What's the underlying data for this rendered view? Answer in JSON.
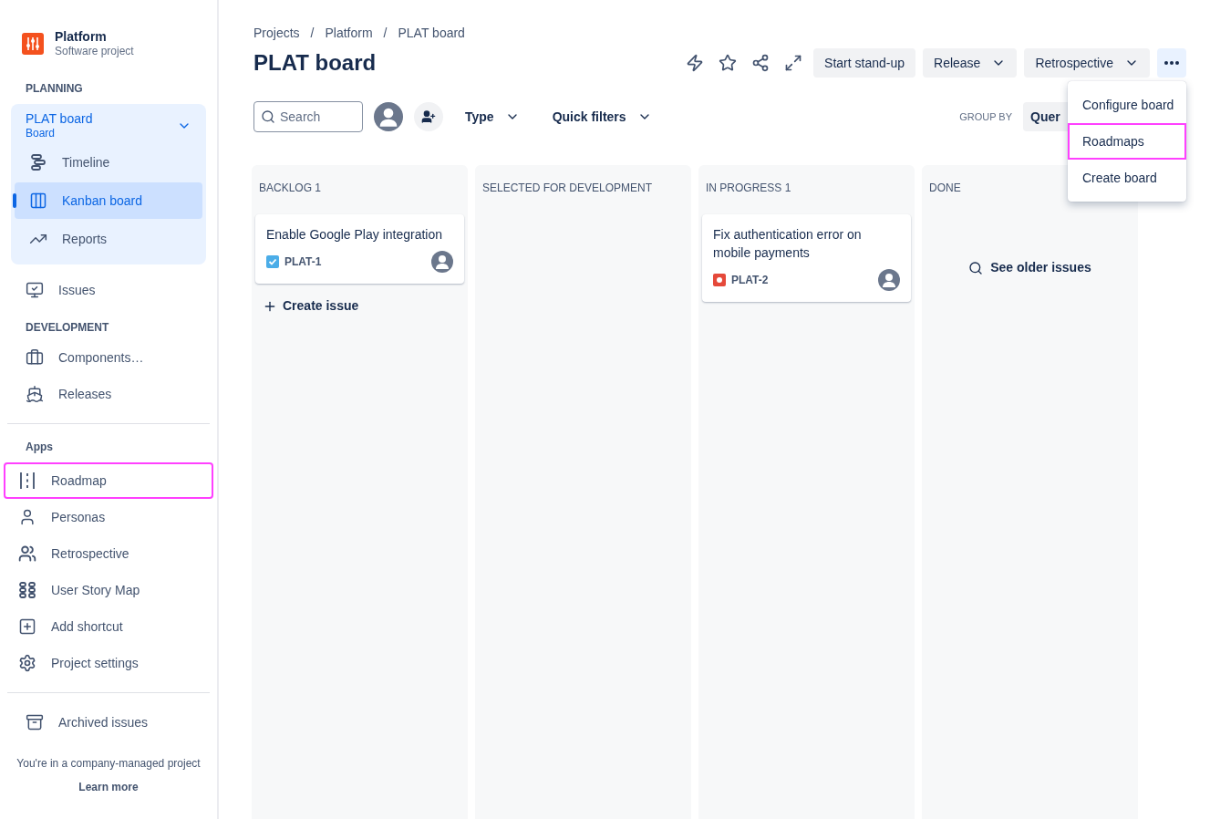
{
  "sidebar": {
    "project": {
      "name": "Platform",
      "type": "Software project"
    },
    "planning": {
      "heading": "PLANNING",
      "board": {
        "name": "PLAT board",
        "subtitle": "Board",
        "expanded": true
      },
      "items": [
        {
          "label": "Timeline",
          "selected": false
        },
        {
          "label": "Kanban board",
          "selected": true
        },
        {
          "label": "Reports",
          "selected": false
        }
      ]
    },
    "issues": {
      "label": "Issues"
    },
    "development": {
      "heading": "DEVELOPMENT",
      "items": [
        {
          "label": "Components…"
        },
        {
          "label": "Releases"
        }
      ]
    },
    "apps": {
      "heading": "Apps",
      "items": [
        {
          "label": "Roadmap",
          "highlighted": true
        },
        {
          "label": "Personas",
          "highlighted": false
        },
        {
          "label": "Retrospective",
          "highlighted": false
        },
        {
          "label": "User Story Map",
          "highlighted": false
        },
        {
          "label": "Add shortcut",
          "highlighted": false
        },
        {
          "label": "Project settings",
          "highlighted": false
        }
      ]
    },
    "archived": {
      "label": "Archived issues"
    },
    "footer": {
      "text": "You're in a company-managed project",
      "link": "Learn more"
    }
  },
  "breadcrumbs": {
    "separator": "/",
    "items": [
      "Projects",
      "Platform",
      "PLAT board"
    ]
  },
  "title": "PLAT board",
  "actions": {
    "buttons": [
      {
        "label": "Start stand-up",
        "dropdown": false
      },
      {
        "label": "Release",
        "dropdown": true
      },
      {
        "label": "Retrospective",
        "dropdown": true
      }
    ],
    "more_open": true
  },
  "more_menu": [
    {
      "label": "Configure board",
      "highlighted": false
    },
    {
      "label": "Roadmaps",
      "highlighted": true
    },
    {
      "label": "Create board",
      "highlighted": false
    }
  ],
  "filters": {
    "search_placeholder": "Search",
    "type": "Type",
    "quick_filters": "Quick filters",
    "group_by_label": "GROUP BY",
    "group_by_value": "Quer"
  },
  "columns": [
    {
      "title": "BACKLOG 1",
      "cards": [
        {
          "summary": "Enable Google Play integration",
          "key": "PLAT-1",
          "kind": "task"
        }
      ],
      "create": "Create issue"
    },
    {
      "title": "SELECTED FOR DEVELOPMENT"
    },
    {
      "title": "IN PROGRESS 1",
      "cards": [
        {
          "summary": "Fix authentication error on mobile payments",
          "key": "PLAT-2",
          "kind": "bug"
        }
      ]
    },
    {
      "title": "DONE",
      "older": "See older issues"
    }
  ]
}
